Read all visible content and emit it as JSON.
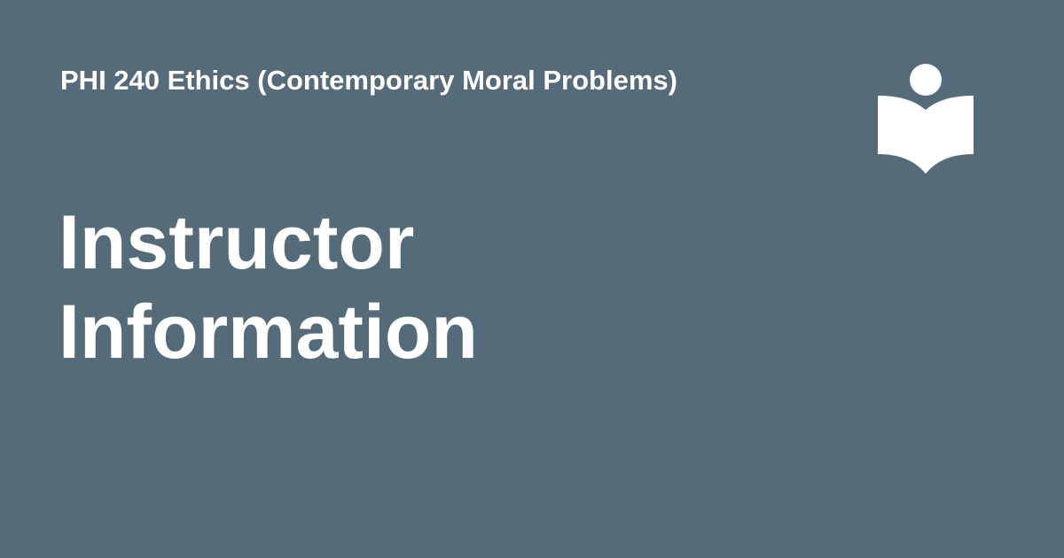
{
  "header": {
    "course_title": "PHI 240 Ethics (Contemporary Moral Problems)"
  },
  "main": {
    "title_lines": [
      "Instructor",
      "Information"
    ]
  },
  "branding": {
    "icon": "reader-book-icon"
  },
  "colors": {
    "background": "#556b79",
    "text": "#ffffff"
  }
}
